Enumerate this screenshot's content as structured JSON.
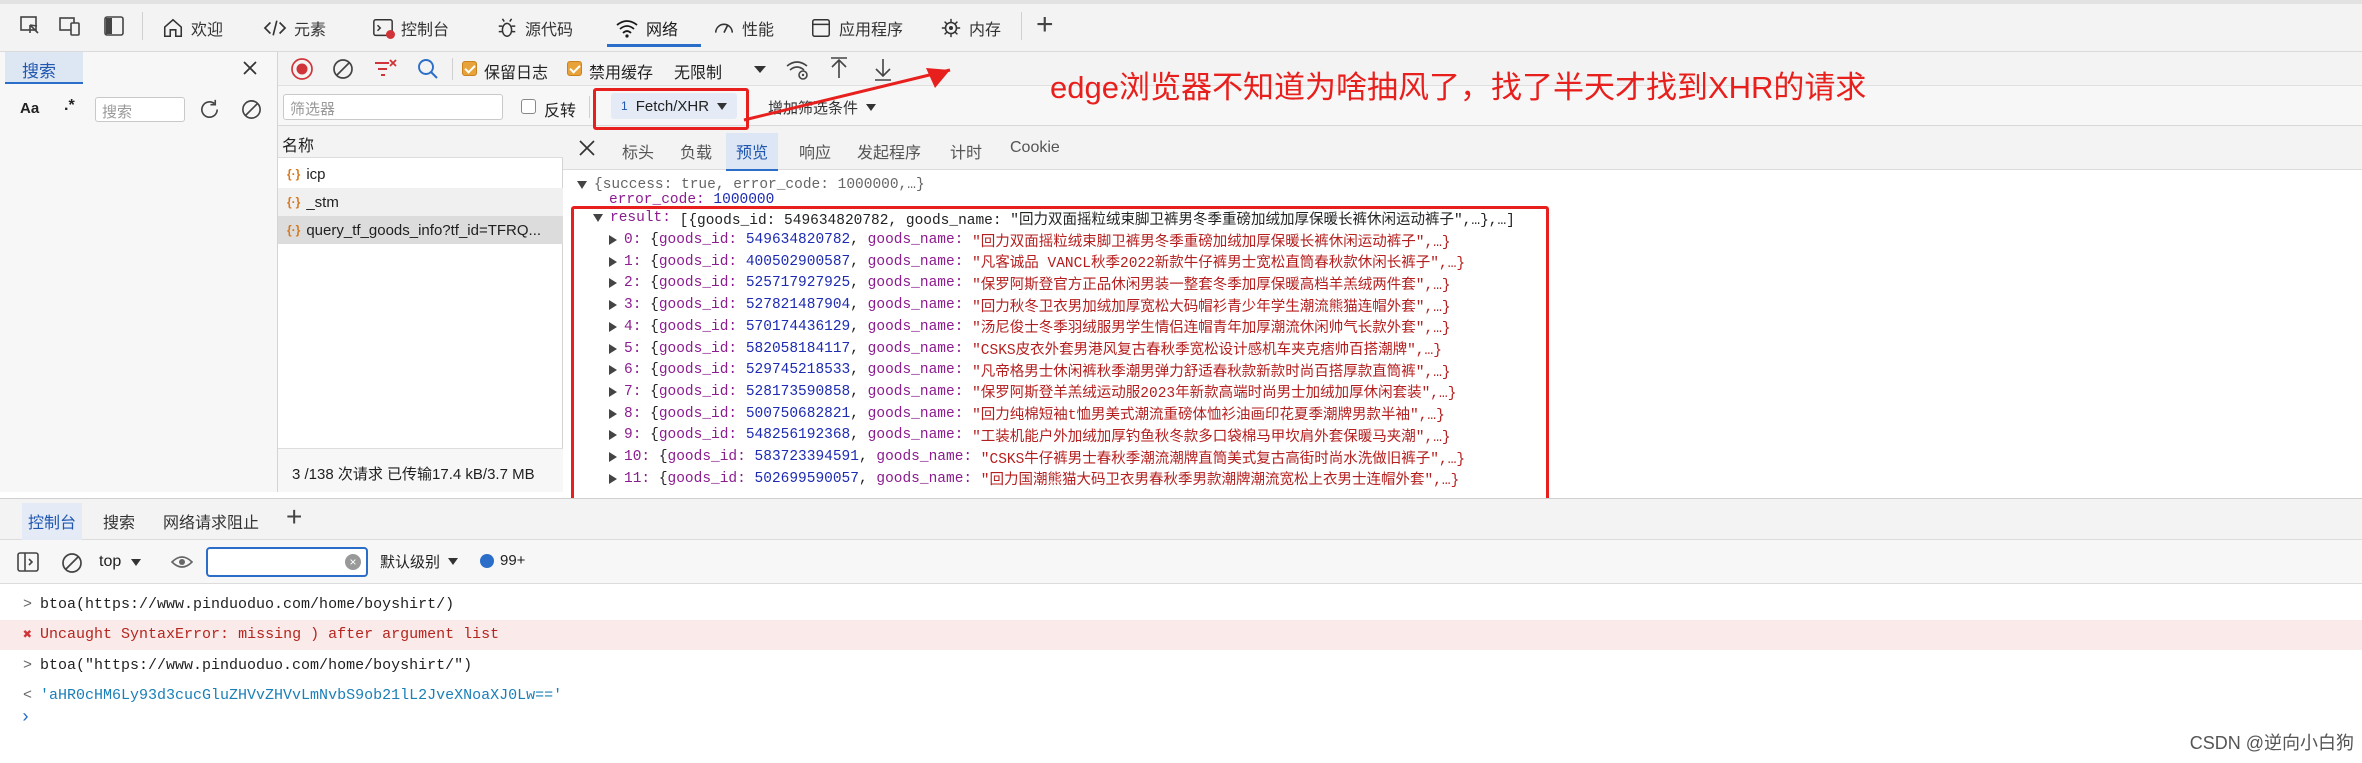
{
  "top_tabs": [
    {
      "label": "欢迎",
      "icon": "home-icon"
    },
    {
      "label": "元素",
      "icon": "code-icon"
    },
    {
      "label": "控制台",
      "icon": "console-icon"
    },
    {
      "label": "源代码",
      "icon": "bug-icon"
    },
    {
      "label": "网络",
      "icon": "wifi-icon",
      "active": true
    },
    {
      "label": "性能",
      "icon": "gauge-icon"
    },
    {
      "label": "应用程序",
      "icon": "app-icon"
    },
    {
      "label": "内存",
      "icon": "memory-icon"
    }
  ],
  "add_tab_label": "+",
  "search_panel": {
    "tab_label": "搜索",
    "case_toggle": "Aa",
    "regex_toggle": ".*",
    "placeholder": "搜索"
  },
  "network_toolbar": {
    "preserve_log_label": "保留日志",
    "preserve_log": true,
    "disable_cache_label": "禁用缓存",
    "disable_cache": true,
    "throttle": "无限制"
  },
  "filter_bar": {
    "placeholder": "筛选器",
    "invert_label": "反转",
    "invert": false,
    "type_filter_count": "1",
    "type_filter": "Fetch/XHR",
    "more_filters": "增加筛选条件"
  },
  "request_list": {
    "column_header": "名称",
    "requests": [
      {
        "name": "icp"
      },
      {
        "name": "_stm"
      },
      {
        "name": "query_tf_goods_info?tf_id=TFRQ..."
      }
    ],
    "status": "3 /138 次请求  已传输17.4 kB/3.7 MB"
  },
  "detail_tabs": [
    "标头",
    "负载",
    "预览",
    "响应",
    "发起程序",
    "计时",
    "Cookie"
  ],
  "detail_active_tab": "预览",
  "preview": {
    "summary": "{success: true, error_code: 1000000,…}",
    "error_code_key": "error_code:",
    "error_code_val": "1000000",
    "result_key": "result:",
    "result_summary": "[{goods_id: 549634820782, goods_name: \"回力双面摇粒绒束脚卫裤男冬季重磅加绒加厚保暖长裤休闲运动裤子\",…},…]",
    "items": [
      {
        "index": "0:",
        "goods_id": "549634820782",
        "goods_name": "\"回力双面摇粒绒束脚卫裤男冬季重磅加绒加厚保暖长裤休闲运动裤子\",…}"
      },
      {
        "index": "1:",
        "goods_id": "400502900587",
        "goods_name": "\"凡客诚品 VANCL秋季2022新款牛仔裤男士宽松直筒春秋款休闲长裤子\",…}"
      },
      {
        "index": "2:",
        "goods_id": "525717927925",
        "goods_name": "\"保罗阿斯登官方正品休闲男装一整套冬季加厚保暖高档羊羔绒两件套\",…}"
      },
      {
        "index": "3:",
        "goods_id": "527821487904",
        "goods_name": "\"回力秋冬卫衣男加绒加厚宽松大码帽衫青少年学生潮流熊猫连帽外套\",…}"
      },
      {
        "index": "4:",
        "goods_id": "570174436129",
        "goods_name": "\"汤尼俊士冬季羽绒服男学生情侣连帽青年加厚潮流休闲帅气长款外套\",…}"
      },
      {
        "index": "5:",
        "goods_id": "582058184117",
        "goods_name": "\"CSKS皮衣外套男港风复古春秋季宽松设计感机车夹克痞帅百搭潮牌\",…}"
      },
      {
        "index": "6:",
        "goods_id": "529745218533",
        "goods_name": "\"凡帝格男士休闲裤秋季潮男弹力舒适春秋款新款时尚百搭厚款直筒裤\",…}"
      },
      {
        "index": "7:",
        "goods_id": "528173590858",
        "goods_name": "\"保罗阿斯登羊羔绒运动服2023年新款高端时尚男士加绒加厚休闲套装\",…}"
      },
      {
        "index": "8:",
        "goods_id": "500750682821",
        "goods_name": "\"回力纯棉短袖t恤男美式潮流重磅体恤衫油画印花夏季潮牌男款半袖\",…}"
      },
      {
        "index": "9:",
        "goods_id": "548256192368",
        "goods_name": "\"工装机能户外加绒加厚钓鱼秋冬款多口袋棉马甲坎肩外套保暖马夹潮\",…}"
      },
      {
        "index": "10:",
        "goods_id": "583723394591",
        "goods_name": "\"CSKS牛仔裤男士春秋季潮流潮牌直筒美式复古高街时尚水洗做旧裤子\",…}"
      },
      {
        "index": "11:",
        "goods_id": "502699590057",
        "goods_name": "\"回力国潮熊猫大码卫衣男春秋季男款潮牌潮流宽松上衣男士连帽外套\",…}"
      }
    ]
  },
  "annotation": "edge浏览器不知道为啥抽风了，找了半天才找到XHR的请求",
  "drawer_tabs": [
    "控制台",
    "搜索",
    "网络请求阻止"
  ],
  "console_toolbar": {
    "context": "top",
    "level": "默认级别",
    "issues": "99+"
  },
  "console_lines": [
    {
      "prefix": ">",
      "text": "btoa(https://www.pinduoduo.com/home/boyshirt/)",
      "kind": "input"
    },
    {
      "prefix": "✖",
      "text": "Uncaught SyntaxError: missing ) after argument list",
      "kind": "error"
    },
    {
      "prefix": ">",
      "text": "btoa(\"https://www.pinduoduo.com/home/boyshirt/\")",
      "kind": "input"
    },
    {
      "prefix": "<",
      "text": "'aHR0cHM6Ly93d3cucGluZHVvZHVvLmNvbS9ob21lL2JveXNoaXJ0Lw=='",
      "kind": "result"
    }
  ],
  "watermark": "CSDN @逆向小白狗",
  "colors": {
    "accent": "#2b6ec9",
    "annotation_red": "#e8201d",
    "checkbox_orange": "#e8a23a",
    "json_key": "#8b1c8f",
    "json_number": "#1d2bb3",
    "json_string": "#b51e1e"
  }
}
